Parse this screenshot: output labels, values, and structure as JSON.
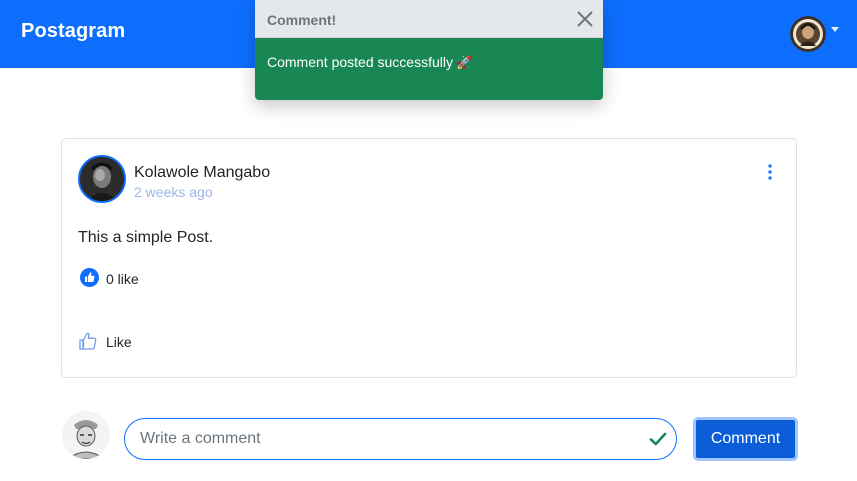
{
  "navbar": {
    "brand": "Postagram",
    "avatar_icon": "user-avatar",
    "dropdown_icon": "caret-down-icon",
    "background": "#0d6efd"
  },
  "toast": {
    "title": "Comment!",
    "message": "Comment posted successfully",
    "emoji": "🚀",
    "close_icon": "close-icon",
    "body_color": "#198754"
  },
  "post": {
    "author": "Kolawole Mangabo",
    "time": "2 weeks ago",
    "text": "This a simple Post.",
    "like_count": "0 like",
    "like_button": "Like",
    "menu_icon": "more-vertical-icon"
  },
  "comment_form": {
    "placeholder": "Write a comment",
    "value": "",
    "submit": "Comment",
    "valid_icon": "check-icon"
  }
}
